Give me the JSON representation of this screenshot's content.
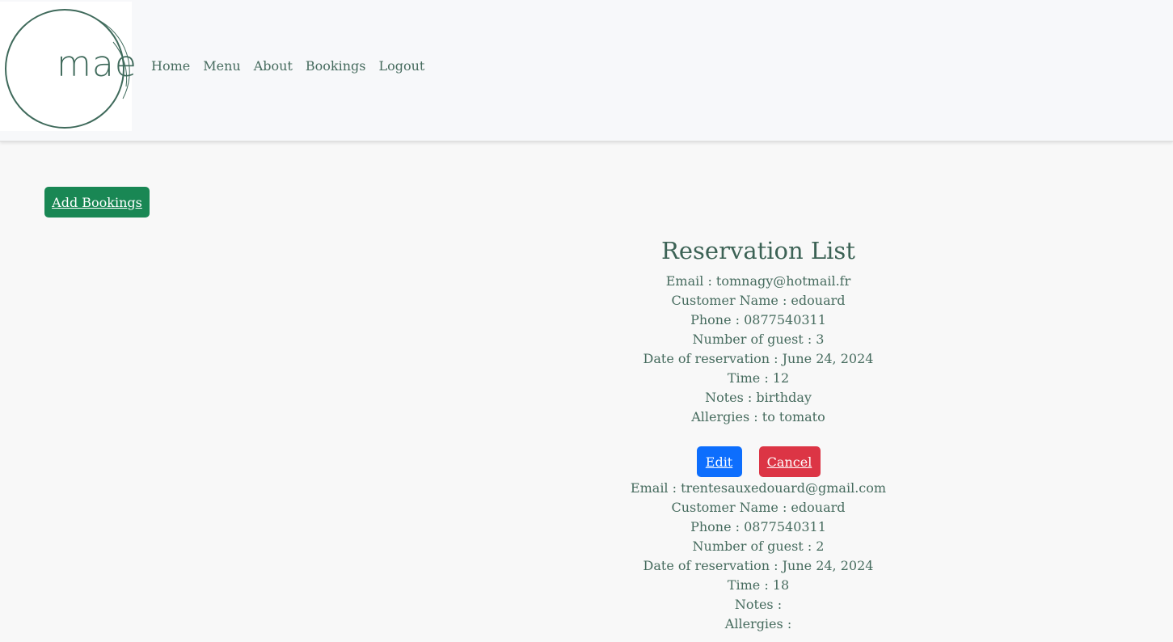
{
  "brand": {
    "logo_text": "mae"
  },
  "nav": {
    "items": [
      {
        "label": "Home"
      },
      {
        "label": "Menu"
      },
      {
        "label": "About"
      },
      {
        "label": "Bookings"
      },
      {
        "label": "Logout"
      }
    ]
  },
  "actions": {
    "add_label": "Add Bookings"
  },
  "list": {
    "title": "Reservation List",
    "reservations": [
      {
        "email": "Email : tomnagy@hotmail.fr",
        "customer": "Customer Name : edouard",
        "phone": "Phone : 0877540311",
        "guests": "Number of guest : 3",
        "date": "Date of reservation : June 24, 2024",
        "time": "Time : 12",
        "notes": "Notes : birthday",
        "allergies": "Allergies : to tomato",
        "edit_label": "Edit",
        "cancel_label": "Cancel"
      },
      {
        "email": "Email : trentesauxedouard@gmail.com",
        "customer": "Customer Name : edouard",
        "phone": "Phone : 0877540311",
        "guests": "Number of guest : 2",
        "date": "Date of reservation : June 24, 2024",
        "time": "Time : 18",
        "notes": "Notes :",
        "allergies": "Allergies :"
      }
    ]
  },
  "colors": {
    "add_button": "#198754",
    "edit_button": "#0d6efd",
    "cancel_button": "#dc3545",
    "text": "#466b5e"
  }
}
